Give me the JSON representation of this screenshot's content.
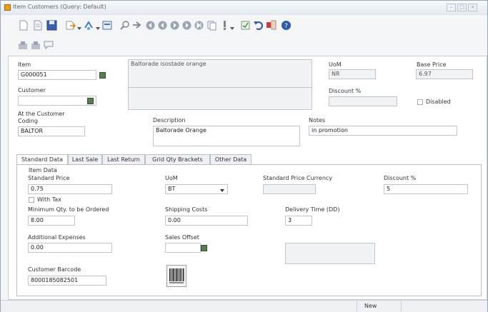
{
  "window": {
    "title": "Item Customers (Query: Default)"
  },
  "toolbar": {
    "icons": [
      "new-icon",
      "open-icon",
      "save-icon",
      "export-icon",
      "import-icon",
      "preview-icon",
      "search-icon",
      "next-icon",
      "first-icon",
      "prev-icon",
      "play-icon",
      "last-icon",
      "copy-icon",
      "alert-icon",
      "history-icon",
      "undo-icon",
      "workflow-icon",
      "help-icon"
    ]
  },
  "form": {
    "item_label": "Item",
    "item_value": "G000051",
    "item_description": "Baltorade isostade orange",
    "uom_label": "UoM",
    "uom_value": "NR",
    "base_price_label": "Base Price",
    "base_price_value": "6.97",
    "customer_label": "Customer",
    "customer_value": "",
    "discount_label": "Discount %",
    "discount_value": "",
    "disabled_label": "Disabled",
    "coding_label_line1": "At the Customer",
    "coding_label_line2": "Coding",
    "coding_value": "BALTOR",
    "description_label": "Description",
    "description_value": "Baltorade Orange",
    "notes_label": "Notes",
    "notes_value": "in promotion"
  },
  "tabs": [
    "Standard Data",
    "Last Sale",
    "Last Return",
    "Grid Qty Brackets",
    "Other Data"
  ],
  "item_data": {
    "group_label": "Item Data",
    "standard_price_label": "Standard Price",
    "standard_price_value": "0.75",
    "with_tax_label": "With Tax",
    "uom_label": "UoM",
    "uom_value": "BT",
    "spc_label": "Standard Price Currency",
    "discount_label": "Discount %",
    "discount_value": "5",
    "min_qty_label": "Minimum Qty. to be Ordered",
    "min_qty_value": "8.00",
    "shipping_label": "Shipping Costs",
    "shipping_value": "0.00",
    "delivery_label": "Delivery Time (DD)",
    "delivery_value": "3",
    "additional_label": "Additional Expenses",
    "additional_value": "0.00",
    "sales_offset_label": "Sales Offset",
    "barcode_label": "Customer Barcode",
    "barcode_value": "8000185082501"
  },
  "status": {
    "mode": "New"
  }
}
